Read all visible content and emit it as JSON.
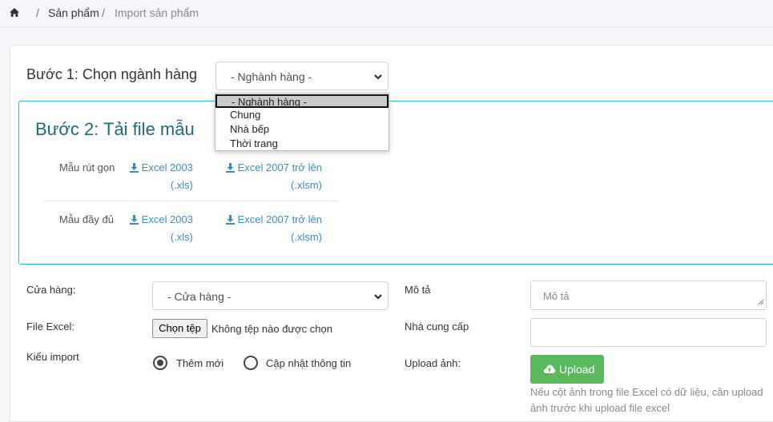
{
  "breadcrumb": {
    "home_icon": "home-icon",
    "separator": "/",
    "items": [
      "Sản phẩm",
      "Import sản phẩm"
    ]
  },
  "step1": {
    "label": "Bước 1: Chọn ngành hàng",
    "select_value": "- Nghành hàng -",
    "dropdown_options": [
      "- Nghành hàng -",
      "Chung",
      "Nhà bếp",
      "Thời trang"
    ]
  },
  "step2": {
    "title": "Bước 2: Tải file mẫu",
    "rows": [
      {
        "label": "Mẫu rút gọn",
        "link_2003": [
          "Excel 2003",
          "(.xls)"
        ],
        "link_2007": [
          "Excel 2007 trở lên",
          "(.xlsm)"
        ]
      },
      {
        "label": "Mẫu đầy đủ",
        "link_2003": [
          "Excel 2003",
          "(.xls)"
        ],
        "link_2007": [
          "Excel 2007 trở lên",
          "(.xlsm)"
        ]
      }
    ]
  },
  "form": {
    "store_label": "Cửa hàng:",
    "store_value": "- Cửa hàng -",
    "file_label": "File Excel:",
    "file_button": "Chọn tệp",
    "file_status": "Không tệp nào được chọn",
    "import_type_label": "Kiểu import",
    "radio_options": [
      {
        "label": "Thêm mới",
        "checked": true
      },
      {
        "label": "Cập nhật thông tin",
        "checked": false
      }
    ],
    "description_label": "Mô tả",
    "description_placeholder": "Mô tả",
    "supplier_label": "Nhà cung cấp",
    "supplier_value": "",
    "upload_image_label": "Upload ảnh:",
    "upload_button": "Upload",
    "upload_help": "Nếu cột ảnh trong file Excel có dữ liệu, cần upload ảnh trước khi upload file excel"
  },
  "colors": {
    "link": "#3c8dbc",
    "step2_border": "#3bb0c0",
    "step2_title": "#1d6a78",
    "upload_button": "#5cb85c"
  }
}
